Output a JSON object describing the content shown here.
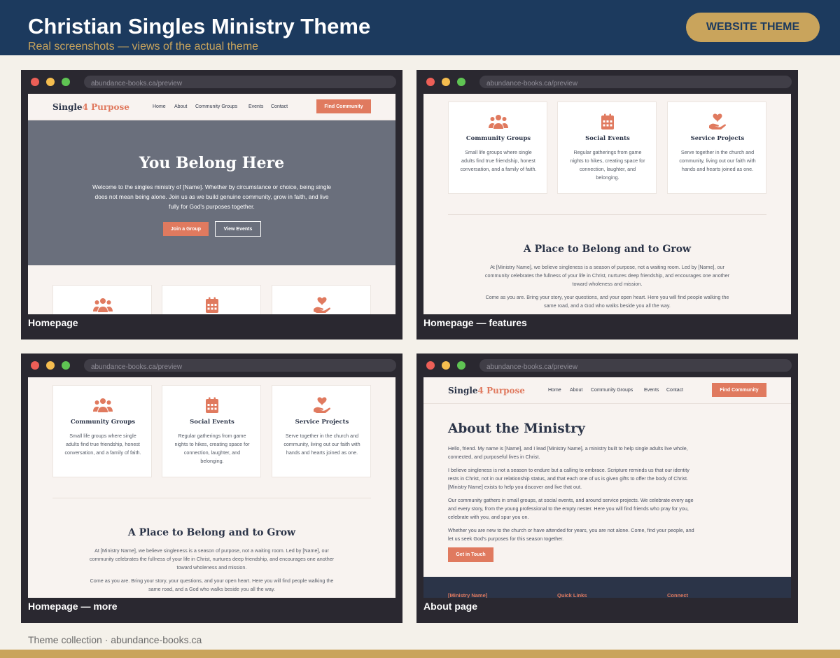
{
  "header": {
    "title": "Christian Singles Ministry Theme",
    "subtitle": "Real screenshots — views of the actual theme",
    "badge": "WEBSITE THEME"
  },
  "browser": {
    "url": "abundance-books.ca/preview"
  },
  "site": {
    "brand_main": "Single",
    "brand_accent": "4 Purpose",
    "nav": [
      "Home",
      "About",
      "Community Groups",
      "Events",
      "Contact"
    ],
    "cta": "Find Community"
  },
  "hero": {
    "title": "You Belong Here",
    "text": "Welcome to the singles ministry of [Name]. Whether by circumstance or choice, being single does not mean being alone. Join us as we build genuine community, grow in faith, and live fully for God's purposes together.",
    "primary_button": "Join a Group",
    "secondary_button": "View Events"
  },
  "features": [
    {
      "icon": "people-icon",
      "title": "Community Groups",
      "text": "Small life groups where single adults find true friendship, honest conversation, and a family of faith."
    },
    {
      "icon": "calendar-icon",
      "title": "Social Events",
      "text": "Regular gatherings from game nights to hikes, creating space for connection, laughter, and belonging."
    },
    {
      "icon": "heart-hand-icon",
      "title": "Service Projects",
      "text": "Serve together in the church and community, living out our faith with hands and hearts joined as one."
    }
  ],
  "belong": {
    "title": "A Place to Belong and to Grow",
    "para1": "At [Ministry Name], we believe singleness is a season of purpose, not a waiting room. Led by [Name], our community celebrates the fullness of your life in Christ, nurtures deep friendship, and encourages one another toward wholeness and mission.",
    "para2": "Come as you are. Bring your story, your questions, and your open heart. Here you will find people walking the same road, and a God who walks beside you all the way."
  },
  "about": {
    "title": "About the Ministry",
    "paragraphs": [
      "Hello, friend. My name is [Name], and I lead [Ministry Name], a ministry built to help single adults live whole, connected, and purposeful lives in Christ.",
      "I believe singleness is not a season to endure but a calling to embrace. Scripture reminds us that our identity rests in Christ, not in our relationship status, and that each one of us is given gifts to offer the body of Christ. [Ministry Name] exists to help you discover and live that out.",
      "Our community gathers in small groups, at social events, and around service projects. We celebrate every age and every story, from the young professional to the empty nester. Here you will find friends who pray for you, celebrate with you, and spur you on.",
      "Whether you are new to the church or have attended for years, you are not alone. Come, find your people, and let us seek God's purposes for this season together."
    ],
    "button": "Get in Touch",
    "footer": [
      "[Ministry Name]",
      "Quick Links",
      "Connect"
    ]
  },
  "captions": [
    "Homepage",
    "Homepage — features",
    "Homepage — more",
    "About page"
  ],
  "credit": "Theme collection · abundance-books.ca",
  "colors": {
    "navy": "#1c3a5e",
    "gold": "#c9a45c",
    "coral": "#e07a5f",
    "hero": "#6a6f7c"
  }
}
